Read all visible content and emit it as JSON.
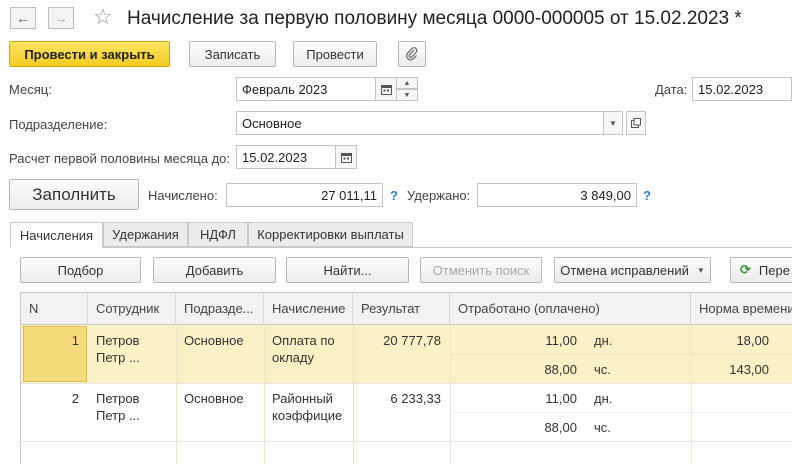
{
  "window": {
    "title": "Начисление за первую половину месяца 0000-000005 от 15.02.2023 *",
    "back_icon": "←",
    "forward_icon": "→",
    "star_icon": "☆"
  },
  "toolbar": {
    "post_close": "Провести и закрыть",
    "save": "Записать",
    "post": "Провести",
    "attach_icon": "📎"
  },
  "form": {
    "month_label": "Месяц:",
    "month_value": "Февраль 2023",
    "date_label": "Дата:",
    "date_value": "15.02.2023",
    "division_label": "Подразделение:",
    "division_value": "Основное",
    "calc_until_label": "Расчет первой половины месяца до:",
    "calc_until_value": "15.02.2023",
    "fill_button": "Заполнить",
    "accrued_label": "Начислено:",
    "accrued_value": "27 011,11",
    "withheld_label": "Удержано:",
    "withheld_value": "3 849,00",
    "help_mark": "?"
  },
  "tabs": [
    "Начисления",
    "Удержания",
    "НДФЛ",
    "Корректировки выплаты"
  ],
  "table_toolbar": {
    "pick": "Подбор",
    "add": "Добавить",
    "find": "Найти...",
    "cancel_search": "Отменить поиск",
    "cancel_fixes": "Отмена исправлений",
    "recalc": "Пере"
  },
  "table": {
    "headers": [
      "N",
      "Сотрудник",
      "Подразде...",
      "Начисление",
      "Результат",
      "Отработано (оплачено)",
      "Норма времени"
    ],
    "rows": [
      {
        "n": "1",
        "employee_1": "Петров",
        "employee_2": "Петр ...",
        "division": "Основное",
        "accrual_1": "Оплата по",
        "accrual_2": "окладу",
        "result": "20 777,78",
        "worked_days": "11,00",
        "worked_days_unit": "дн.",
        "worked_hours": "88,00",
        "worked_hours_unit": "чс.",
        "norm_days": "18,00",
        "norm_hours": "143,00"
      },
      {
        "n": "2",
        "employee_1": "Петров",
        "employee_2": "Петр ...",
        "division": "Основное",
        "accrual_1": "Районный",
        "accrual_2": "коэффицие",
        "result": "6 233,33",
        "worked_days": "11,00",
        "worked_days_unit": "дн.",
        "worked_hours": "88,00",
        "worked_hours_unit": "чс."
      }
    ]
  }
}
